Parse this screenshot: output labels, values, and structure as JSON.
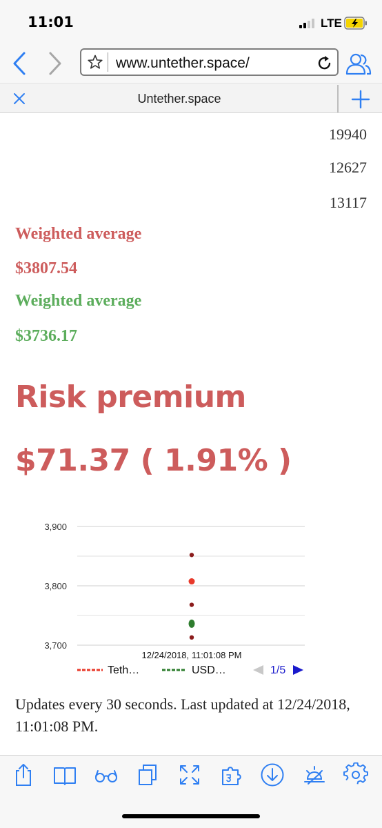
{
  "status": {
    "time": "11:01",
    "network": "LTE"
  },
  "browser": {
    "url": "www.untether.space/",
    "tab_title": "Untether.space"
  },
  "page": {
    "numbers": [
      "19940",
      "12627",
      "13117"
    ],
    "weighted_label_1": "Weighted average",
    "weighted_value_1": "$3807.54",
    "weighted_label_2": "Weighted average",
    "weighted_value_2": "$3736.17",
    "risk_title": "Risk premium",
    "risk_value": "$71.37 ( 1.91% )",
    "footer": "Updates every 30 seconds. Last updated at 12/24/2018, 11:01:08 PM.",
    "colors": {
      "red": "#cd5c5c",
      "green": "#5cad5c"
    }
  },
  "chart_data": {
    "type": "scatter",
    "x_label": "12/24/2018, 11:01:08 PM",
    "ylim": [
      3700,
      3900
    ],
    "y_ticks": [
      "3,900",
      "3,800",
      "3,700"
    ],
    "grid": true,
    "legend": {
      "position": "bottom",
      "entries": [
        "Teth…",
        "USD…"
      ],
      "page": "1/5"
    },
    "series": [
      {
        "name": "Teth…",
        "color": "#e8392a",
        "values": [
          3807.54
        ]
      },
      {
        "name": "USD…",
        "color": "#2e7d2e",
        "values": [
          3736.17
        ]
      },
      {
        "name": "",
        "color": "#8b1c1c",
        "values": [
          3852,
          3768,
          3713
        ]
      }
    ]
  },
  "toolbar": {
    "icons": [
      "share-icon",
      "book-icon",
      "glasses-icon",
      "tabs-icon",
      "expand-icon",
      "puzzle-icon",
      "download-icon",
      "night-mode-icon",
      "settings-icon"
    ]
  }
}
